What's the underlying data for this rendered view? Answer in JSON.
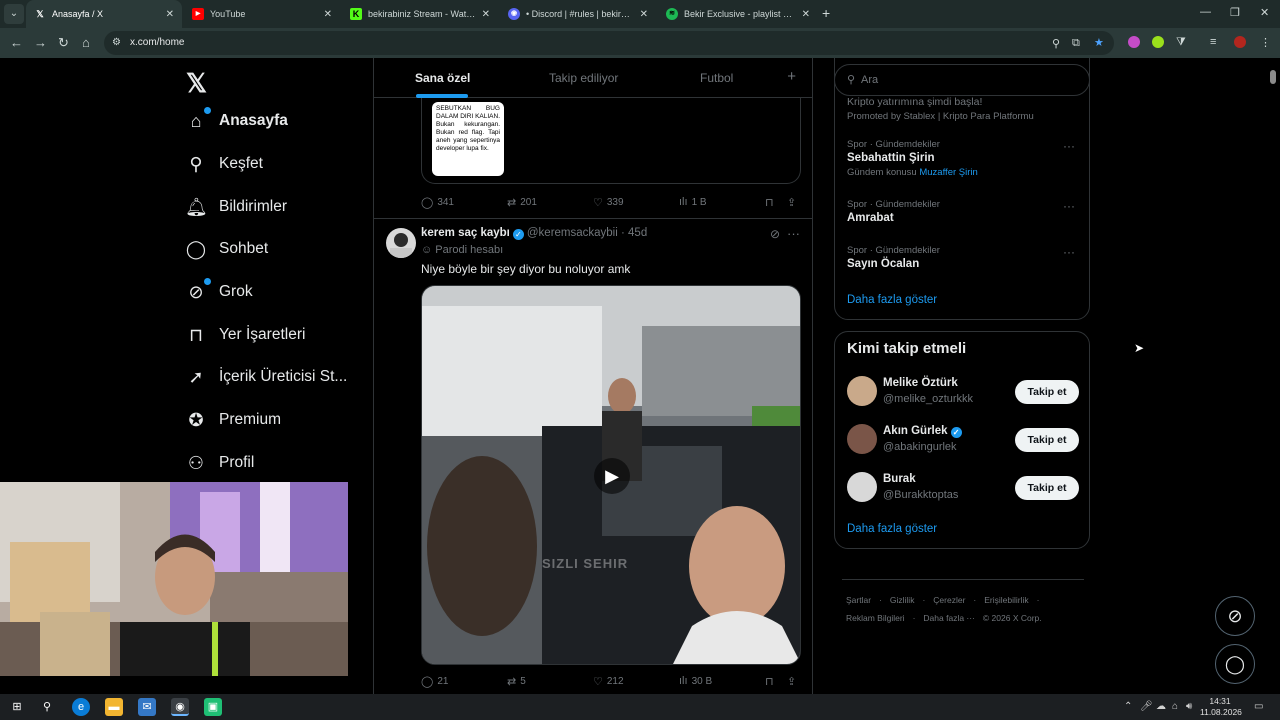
{
  "browser": {
    "tabs": [
      {
        "title": "Anasayfa / X",
        "icon": "x-logo-icon",
        "active": true
      },
      {
        "title": "YouTube",
        "icon": "youtube-icon",
        "active": false
      },
      {
        "title": "bekirabiniz Stream - Watch Live",
        "icon": "kick-icon",
        "active": false
      },
      {
        "title": "• Discord | #rules | bekirabiniz",
        "icon": "discord-icon",
        "active": false
      },
      {
        "title": "Bekir Exclusive - playlist by Bekir",
        "icon": "spotify-icon",
        "active": false
      }
    ],
    "url": "x.com/home"
  },
  "nav": {
    "logo": "𝕏",
    "items": [
      {
        "label": "Anasayfa",
        "icon": "home-icon"
      },
      {
        "label": "Keşfet",
        "icon": "search-icon"
      },
      {
        "label": "Bildirimler",
        "icon": "bell-icon"
      },
      {
        "label": "Sohbet",
        "icon": "chat-icon"
      },
      {
        "label": "Grok",
        "icon": "grok-icon"
      },
      {
        "label": "Yer İşaretleri",
        "icon": "bookmark-icon"
      },
      {
        "label": "İçerik Üreticisi St...",
        "icon": "rocket-icon"
      },
      {
        "label": "Premium",
        "icon": "verified-badge-icon"
      },
      {
        "label": "Profil",
        "icon": "profile-icon"
      }
    ]
  },
  "timeline": {
    "tabs": [
      "Sana özel",
      "Takip ediliyor",
      "Futbol"
    ],
    "tweet1": {
      "image_text": "SEBUTKAN BUG DALAM DIRI KALIAN. Bukan kekurangan. Bukan red flag. Tapi aneh yang sepertinya developer lupa fix.",
      "replies": "341",
      "reposts": "201",
      "likes": "339",
      "views": "1 B"
    },
    "tweet2": {
      "name": "kerem saç kaybı",
      "handle": "@keremsackaybii",
      "time": "· 45d",
      "label": "Parodi hesabı",
      "text": "Niye böyle bir şey diyor bu noluyor amk",
      "watermark": "SIZLI SEHIR",
      "replies": "21",
      "reposts": "5",
      "likes": "212",
      "views": "30 B"
    }
  },
  "right": {
    "search_placeholder": "Ara",
    "trends_partial_line": "Kripto yatırımına şimdi başla!",
    "promoted": "Promoted by Stablex | Kripto Para Platformu",
    "trends": [
      {
        "meta": "Spor · Gündemdekiler",
        "name": "Sebahattin Şirin",
        "sub_prefix": "Gündem konusu",
        "sub_link": "Muzaffer Şirin"
      },
      {
        "meta": "Spor · Gündemdekiler",
        "name": "Amrabat"
      },
      {
        "meta": "Spor · Gündemdekiler",
        "name": "Sayın Öcalan"
      }
    ],
    "trends_show_more": "Daha fazla göster",
    "who_title": "Kimi takip etmeli",
    "who": [
      {
        "name": "Melike Öztürk",
        "handle": "@melike_ozturkkk",
        "verified": false,
        "button": "Takip et"
      },
      {
        "name": "Akın Gürlek",
        "handle": "@abakingurlek",
        "verified": true,
        "button": "Takip et"
      },
      {
        "name": "Burak",
        "handle": "@Burakktoptas",
        "verified": false,
        "button": "Takip et"
      }
    ],
    "who_show_more": "Daha fazla göster",
    "footer": [
      "Şartlar",
      "·",
      "Gizlilik",
      "·",
      "Çerezler",
      "·",
      "Erişilebilirlik",
      "·",
      "Reklam Bilgileri",
      "·",
      "Daha fazla ···",
      "© 2026 X Corp."
    ]
  },
  "taskbar": {
    "time": "14:31",
    "date": "11.08.2026"
  }
}
